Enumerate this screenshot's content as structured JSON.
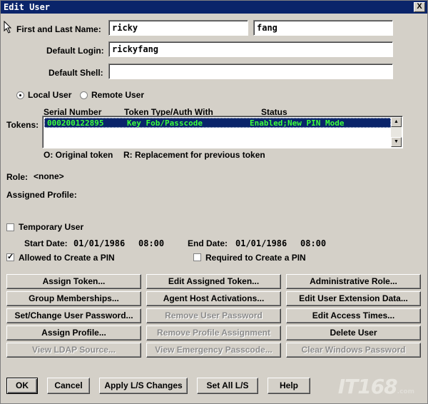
{
  "window": {
    "title": "Edit User",
    "close_glyph": "X"
  },
  "name": {
    "label": "First and Last Name:",
    "first": "ricky",
    "last": "fang"
  },
  "login": {
    "label": "Default Login:",
    "value": "rickyfang"
  },
  "shell": {
    "label": "Default Shell:",
    "value": ""
  },
  "user_type": {
    "local": "Local User",
    "remote": "Remote User",
    "selected": "local"
  },
  "tokens": {
    "label": "Tokens:",
    "headers": [
      "Serial Number",
      "Token Type/Auth With",
      "Status"
    ],
    "rows": [
      {
        "serial": "000200122895",
        "type": "Key Fob/Passcode",
        "status": "Enabled;New PIN Mode"
      }
    ],
    "legend_original": "O: Original token",
    "legend_replacement": "R: Replacement for previous token"
  },
  "role": {
    "label": "Role:",
    "value": "<none>"
  },
  "profile": {
    "label": "Assigned Profile:"
  },
  "temporary": {
    "label": "Temporary User",
    "checked": false
  },
  "dates": {
    "start_label": "Start Date:",
    "start_date": "01/01/1986",
    "start_time": "08:00",
    "end_label": "End Date:",
    "end_date": "01/01/1986",
    "end_time": "08:00"
  },
  "pin": {
    "allowed_label": "Allowed to Create a PIN",
    "allowed_checked": true,
    "required_label": "Required to Create a PIN",
    "required_checked": false
  },
  "actions": {
    "assign_token": "Assign Token...",
    "edit_assigned_token": "Edit Assigned Token...",
    "administrative_role": "Administrative Role...",
    "group_memberships": "Group Memberships...",
    "agent_host_activations": "Agent Host Activations...",
    "edit_user_extension": "Edit User Extension Data...",
    "set_change_password": "Set/Change User Password...",
    "remove_password": "Remove User Password",
    "edit_access_times": "Edit Access Times...",
    "assign_profile": "Assign Profile...",
    "remove_profile": "Remove Profile Assignment",
    "delete_user": "Delete User",
    "view_ldap": "View LDAP Source...",
    "view_emergency": "View Emergency Passcode...",
    "clear_windows_password": "Clear Windows Password"
  },
  "footer": {
    "ok": "OK",
    "cancel": "Cancel",
    "apply": "Apply L/S Changes",
    "set_all": "Set All L/S",
    "help": "Help"
  },
  "watermark": {
    "text": "IT168",
    "sub": ".com"
  }
}
